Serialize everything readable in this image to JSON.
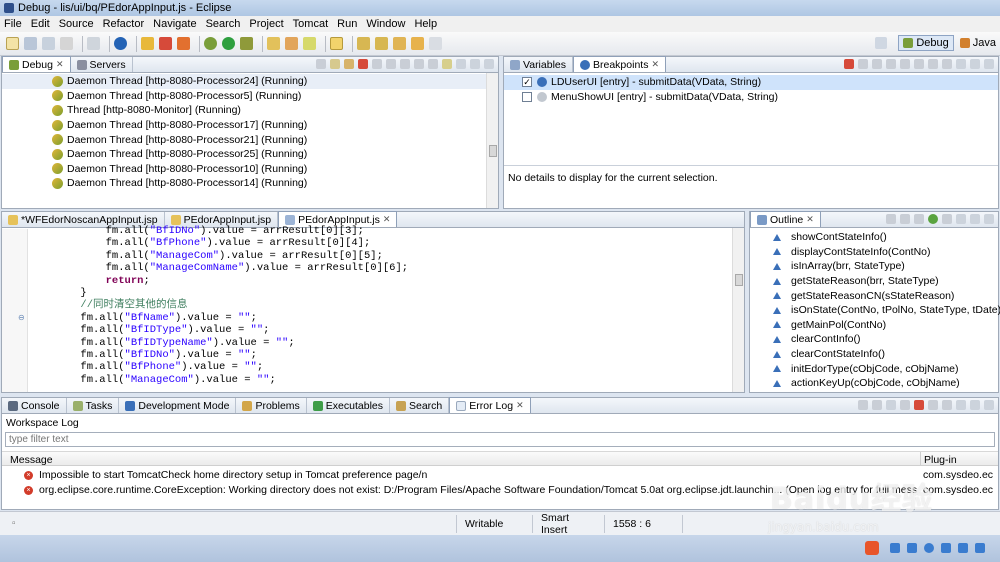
{
  "window": {
    "title": "Debug - lis/ui/bq/PEdorAppInput.js - Eclipse"
  },
  "menu": [
    "File",
    "Edit",
    "Source",
    "Refactor",
    "Navigate",
    "Search",
    "Project",
    "Tomcat",
    "Run",
    "Window",
    "Help"
  ],
  "perspectives": {
    "debug": "Debug",
    "java": "Java"
  },
  "debug_pane": {
    "tabs": [
      {
        "label": "Debug"
      },
      {
        "label": "Servers"
      }
    ],
    "threads": [
      "Daemon Thread [http-8080-Processor24] (Running)",
      "Daemon Thread [http-8080-Processor5] (Running)",
      "Thread [http-8080-Monitor] (Running)",
      "Daemon Thread [http-8080-Processor17] (Running)",
      "Daemon Thread [http-8080-Processor21] (Running)",
      "Daemon Thread [http-8080-Processor25] (Running)",
      "Daemon Thread [http-8080-Processor10] (Running)",
      "Daemon Thread [http-8080-Processor14] (Running)"
    ]
  },
  "breakpoints_pane": {
    "tabs": [
      {
        "label": "Variables"
      },
      {
        "label": "Breakpoints"
      }
    ],
    "items": [
      {
        "label": "LDUserUI [entry] - submitData(VData, String)",
        "checked": true
      },
      {
        "label": "MenuShowUI [entry] - submitData(VData, String)",
        "checked": false
      }
    ],
    "details": "No details to display for the current selection."
  },
  "editor": {
    "tabs": [
      {
        "label": "*WFEdorNoscanAppInput.jsp"
      },
      {
        "label": "PEdorAppInput.jsp"
      },
      {
        "label": "PEdorAppInput.js"
      }
    ],
    "lines": [
      [
        {
          "t": "            fm.all(",
          "c": ""
        },
        {
          "t": "\"BfIDNo\"",
          "c": "str"
        },
        {
          "t": ").value = arrResult[0][3];",
          "c": ""
        }
      ],
      [
        {
          "t": "            fm.all(",
          "c": ""
        },
        {
          "t": "\"BfPhone\"",
          "c": "str"
        },
        {
          "t": ").value = arrResult[0][4];",
          "c": ""
        }
      ],
      [
        {
          "t": "            fm.all(",
          "c": ""
        },
        {
          "t": "\"ManageCom\"",
          "c": "str"
        },
        {
          "t": ").value = arrResult[0][5];",
          "c": ""
        }
      ],
      [
        {
          "t": "            fm.all(",
          "c": ""
        },
        {
          "t": "\"ManageComName\"",
          "c": "str"
        },
        {
          "t": ").value = arrResult[0][6];",
          "c": ""
        }
      ],
      [
        {
          "t": "            ",
          "c": ""
        },
        {
          "t": "return",
          "c": "kw"
        },
        {
          "t": ";",
          "c": ""
        }
      ],
      [
        {
          "t": "        }",
          "c": ""
        }
      ],
      [
        {
          "t": "        ",
          "c": ""
        },
        {
          "t": "//同时清空其他的信息",
          "c": "cm"
        }
      ],
      [
        {
          "t": "        fm.all(",
          "c": ""
        },
        {
          "t": "\"BfName\"",
          "c": "str"
        },
        {
          "t": ").value = ",
          "c": ""
        },
        {
          "t": "\"\"",
          "c": "str"
        },
        {
          "t": ";",
          "c": ""
        }
      ],
      [
        {
          "t": "        fm.all(",
          "c": ""
        },
        {
          "t": "\"BfIDType\"",
          "c": "str"
        },
        {
          "t": ").value = ",
          "c": ""
        },
        {
          "t": "\"\"",
          "c": "str"
        },
        {
          "t": ";",
          "c": ""
        }
      ],
      [
        {
          "t": "        fm.all(",
          "c": ""
        },
        {
          "t": "\"BfIDTypeName\"",
          "c": "str"
        },
        {
          "t": ").value = ",
          "c": ""
        },
        {
          "t": "\"\"",
          "c": "str"
        },
        {
          "t": ";",
          "c": ""
        }
      ],
      [
        {
          "t": "        fm.all(",
          "c": ""
        },
        {
          "t": "\"BfIDNo\"",
          "c": "str"
        },
        {
          "t": ").value = ",
          "c": ""
        },
        {
          "t": "\"\"",
          "c": "str"
        },
        {
          "t": ";",
          "c": ""
        }
      ],
      [
        {
          "t": "        fm.all(",
          "c": ""
        },
        {
          "t": "\"BfPhone\"",
          "c": "str"
        },
        {
          "t": ").value = ",
          "c": ""
        },
        {
          "t": "\"\"",
          "c": "str"
        },
        {
          "t": ";",
          "c": ""
        }
      ],
      [
        {
          "t": "        fm.all(",
          "c": ""
        },
        {
          "t": "\"ManageCom\"",
          "c": "str"
        },
        {
          "t": ").value = ",
          "c": ""
        },
        {
          "t": "\"\"",
          "c": "str"
        },
        {
          "t": ";",
          "c": ""
        }
      ]
    ]
  },
  "outline": {
    "tab": "Outline",
    "items": [
      "showContStateInfo()",
      "displayContStateInfo(ContNo)",
      "isInArray(brr, StateType)",
      "getStateReason(brr, StateType)",
      "getStateReasonCN(sStateReason)",
      "isOnState(ContNo, tPolNo, StateType, tDate)",
      "getMainPol(ContNo)",
      "clearContInfo()",
      "clearContStateInfo()",
      "initEdorType(cObjCode, cObjName)",
      "actionKeyUp(cObjCode, cObjName)"
    ]
  },
  "bottom": {
    "tabs": [
      {
        "label": "Console"
      },
      {
        "label": "Tasks"
      },
      {
        "label": "Development Mode"
      },
      {
        "label": "Problems"
      },
      {
        "label": "Executables"
      },
      {
        "label": "Search"
      },
      {
        "label": "Error Log"
      }
    ],
    "section": "Workspace Log",
    "filter_placeholder": "type filter text",
    "columns": {
      "message": "Message",
      "plugin": "Plug-in"
    },
    "rows": [
      {
        "message": "Impossible to start TomcatCheck home directory setup in Tomcat preference page/n",
        "plugin": "com.sysdeo.ec"
      },
      {
        "message": "org.eclipse.core.runtime.CoreException: Working directory does not exist: D:/Program Files/Apache Software Foundation/Tomcat 5.0at org.eclipse.jdt.launchin... (Open log entry for full message)",
        "plugin": "com.sysdeo.ec"
      }
    ]
  },
  "status": {
    "writable": "Writable",
    "insert": "Smart Insert",
    "position": "1558 : 6"
  },
  "watermark": {
    "brand": "Baidu",
    "cn": "经验",
    "url": "jingyan.baidu.com"
  },
  "colors": {
    "accent": "#3a6fb8",
    "error": "#d23c2a",
    "selection": "#cfe3fb"
  }
}
